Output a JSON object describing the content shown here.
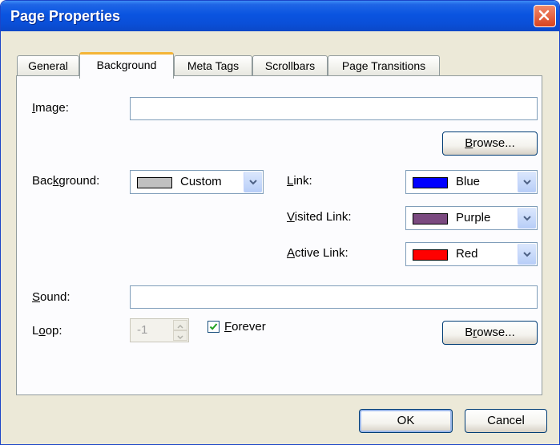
{
  "window": {
    "title": "Page Properties"
  },
  "tabs": [
    {
      "label": "General"
    },
    {
      "label": "Background"
    },
    {
      "label": "Meta Tags"
    },
    {
      "label": "Scrollbars"
    },
    {
      "label": "Page Transitions"
    }
  ],
  "image": {
    "label_prefix": "",
    "label_underline": "I",
    "label_suffix": "mage:",
    "value": ""
  },
  "browse_image": {
    "prefix": "",
    "underline": "B",
    "suffix": "rowse..."
  },
  "background": {
    "label_prefix": "Bac",
    "label_underline": "k",
    "label_suffix": "ground:",
    "value": "Custom",
    "color": "#c0c0c0"
  },
  "link": {
    "label_prefix": "",
    "label_underline": "L",
    "label_suffix": "ink:",
    "value": "Blue",
    "color": "#0000ff"
  },
  "visited_link": {
    "label_prefix": "",
    "label_underline": "V",
    "label_suffix": "isited Link:",
    "value": "Purple",
    "color": "#7b4a80"
  },
  "active_link": {
    "label_prefix": "",
    "label_underline": "A",
    "label_suffix": "ctive Link:",
    "value": "Red",
    "color": "#ff0000"
  },
  "sound": {
    "label_prefix": "",
    "label_underline": "S",
    "label_suffix": "ound:",
    "value": ""
  },
  "loop": {
    "label_prefix": "L",
    "label_underline": "o",
    "label_suffix": "op:",
    "value": "-1"
  },
  "forever": {
    "prefix": "",
    "underline": "F",
    "suffix": "orever",
    "checked": true
  },
  "browse_sound": {
    "prefix": "B",
    "underline": "r",
    "suffix": "owse..."
  },
  "footer": {
    "ok_label": "OK",
    "cancel_label": "Cancel"
  }
}
